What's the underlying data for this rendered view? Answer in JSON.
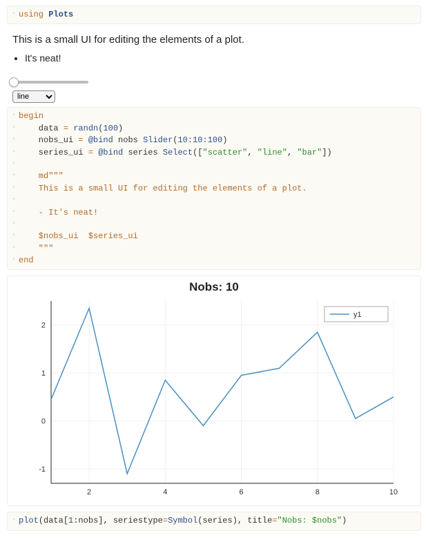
{
  "cell1": {
    "code": "using Plots",
    "tok_using": "using",
    "tok_plots": "Plots"
  },
  "md": {
    "intro": "This is a small UI for editing the elements of a plot.",
    "bullet": "It's neat!"
  },
  "controls": {
    "slider": {
      "min": 10,
      "max": 100,
      "step": 10,
      "value": 10
    },
    "select": {
      "options": [
        "scatter",
        "line",
        "bar"
      ],
      "selected": "line"
    }
  },
  "cell2": {
    "l0": "begin",
    "l1_a": "    data ",
    "l1_eq": "= ",
    "l1_fn": "randn",
    "l1_p": "(",
    "l1_n": "100",
    "l1_q": ")",
    "l2_a": "    nobs_ui ",
    "l2_eq": "= ",
    "l2_mac": "@bind",
    "l2_sp": " ",
    "l2_v": "nobs ",
    "l2_fn": "Slider",
    "l2_p": "(",
    "l2_r": "10:10:100",
    "l2_q": ")",
    "l3_a": "    series_ui ",
    "l3_eq": "= ",
    "l3_mac": "@bind",
    "l3_sp": " ",
    "l3_v": "series ",
    "l3_fn": "Select",
    "l3_p": "([",
    "l3_s1": "\"scatter\"",
    "l3_c1": ", ",
    "l3_s2": "\"line\"",
    "l3_c2": ", ",
    "l3_s3": "\"bar\"",
    "l3_q": "])",
    "l5": "    md\"\"\"",
    "l6": "    This is a small UI for editing the elements of a plot.",
    "l8": "    - It's neat!",
    "l10": "    $nobs_ui  $series_ui",
    "l11": "    \"\"\"",
    "l12": "end"
  },
  "chart_data": {
    "type": "line",
    "title": "Nobs: 10",
    "x": [
      1,
      2,
      3,
      4,
      5,
      6,
      7,
      8,
      9,
      10
    ],
    "values": [
      0.45,
      2.35,
      -1.1,
      0.85,
      -0.1,
      0.95,
      1.1,
      1.85,
      0.05,
      0.5
    ],
    "series_name": "y1",
    "xlabel": "",
    "ylabel": "",
    "xticks": [
      2,
      4,
      6,
      8,
      10
    ],
    "yticks": [
      -1,
      0,
      1,
      2
    ],
    "xlim": [
      1,
      10
    ],
    "ylim": [
      -1.3,
      2.5
    ]
  },
  "cell3": {
    "pre": "plot",
    "p1": "(data[",
    "n1": "1",
    "p2": ":nobs], seriestype",
    "eq": "=",
    "sym": "Symbol",
    "p3": "(series), title",
    "eq2": "=",
    "str": "\"Nobs: $nobs\"",
    "p4": ")"
  }
}
